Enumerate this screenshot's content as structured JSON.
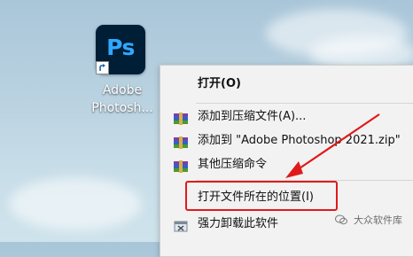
{
  "desktop": {
    "icon_name": "Ps",
    "icon_label_line1": "Adobe",
    "icon_label_line2": "Photosh..."
  },
  "context_menu": {
    "items": [
      {
        "label": "打开(O)",
        "icon": "none"
      },
      {
        "label": "添加到压缩文件(A)...",
        "icon": "winrar-archive-icon"
      },
      {
        "label": "添加到 \"Adobe Photoshop 2021.zip\"",
        "icon": "winrar-archive-icon"
      },
      {
        "label": "其他压缩命令",
        "icon": "winrar-archive-icon"
      },
      {
        "label": "打开文件所在的位置(I)",
        "icon": "none"
      },
      {
        "label": "强力卸载此软件",
        "icon": "uninstall-icon"
      }
    ]
  },
  "annotation": {
    "highlight_color": "#e01a1a"
  },
  "watermark": {
    "text": "大众软件库"
  },
  "colors": {
    "ps_background": "#001e36",
    "ps_text": "#31a8ff",
    "menu_background": "#f2f2f2"
  }
}
